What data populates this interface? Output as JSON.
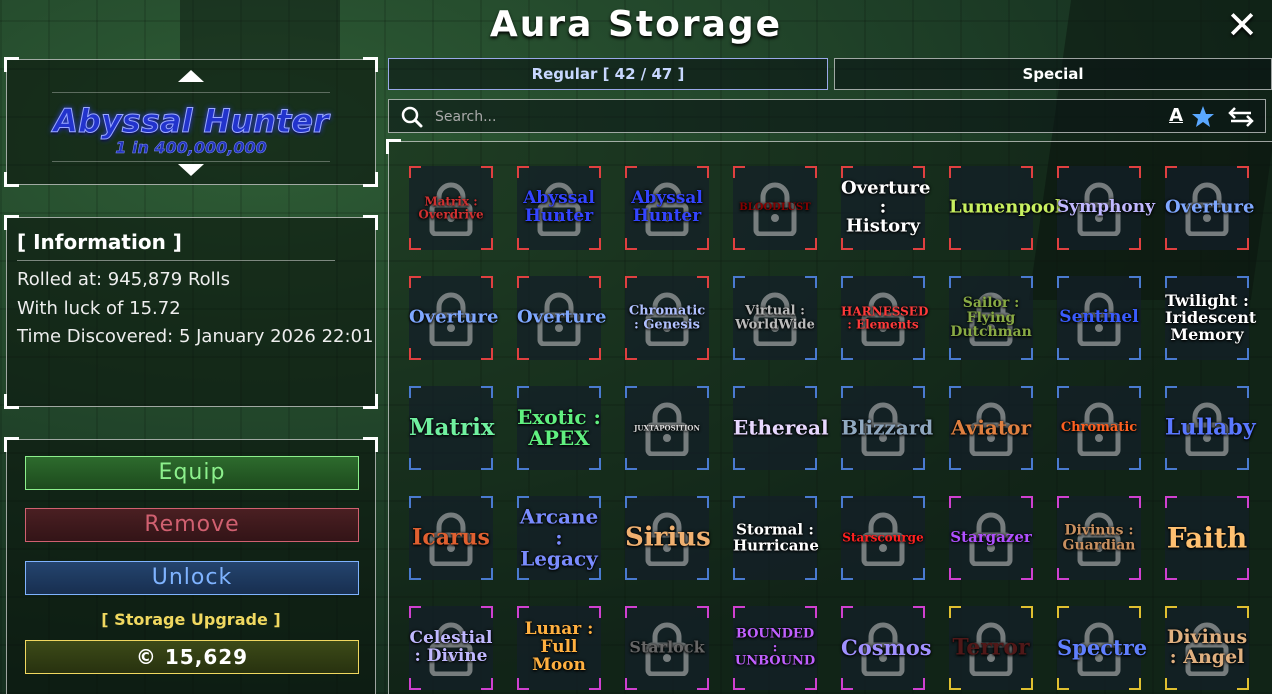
{
  "title": "Aura Storage",
  "close_icon": "close-icon",
  "selected": {
    "name": "Abyssal Hunter",
    "odds": "1 in 400,000,000"
  },
  "info": {
    "heading": "[ Information ]",
    "rolled_at": "Rolled at: 945,879 Rolls",
    "luck": "With luck of 15.72",
    "discovered": "Time Discovered: 5 January 2026 22:01"
  },
  "buttons": {
    "equip": "Equip",
    "remove": "Remove",
    "unlock": "Unlock",
    "upgrade_label": "[ Storage Upgrade ]",
    "price": "© 15,629"
  },
  "tabs": {
    "regular": "Regular [ 42 / 47 ]",
    "special": "Special"
  },
  "search": {
    "placeholder": "Search..."
  },
  "auras": [
    {
      "name": "Matrix : Overdrive",
      "border": "#e04040",
      "locked": true,
      "color": "#d03030",
      "size": 12
    },
    {
      "name": "Abyssal Hunter",
      "border": "#e04040",
      "locked": true,
      "color": "#3344ff",
      "size": 17
    },
    {
      "name": "Abyssal Hunter",
      "border": "#e04040",
      "locked": true,
      "color": "#3344ff",
      "size": 17
    },
    {
      "name": "BLOODLUST",
      "border": "#e04040",
      "locked": true,
      "color": "#880000",
      "size": 10
    },
    {
      "name": "Overture : History",
      "border": "#e04040",
      "locked": false,
      "color": "#ffffff",
      "size": 18
    },
    {
      "name": "Lumenpool",
      "border": "#e04040",
      "locked": false,
      "color": "#c8f060",
      "size": 18
    },
    {
      "name": "Symphony",
      "border": "#e04040",
      "locked": true,
      "color": "#c0b8ff",
      "size": 17
    },
    {
      "name": "Overture",
      "border": "#e04040",
      "locked": true,
      "color": "#7fa8ff",
      "size": 18
    },
    {
      "name": "Overture",
      "border": "#e04040",
      "locked": true,
      "color": "#7fa8ff",
      "size": 18
    },
    {
      "name": "Overture",
      "border": "#e04040",
      "locked": true,
      "color": "#7fa8ff",
      "size": 18
    },
    {
      "name": "Chromatic : Genesis",
      "border": "#e04040",
      "locked": true,
      "color": "#b0c0ff",
      "size": 13
    },
    {
      "name": "Virtual : WorldWide",
      "border": "#4a7ad0",
      "locked": true,
      "color": "#bbbbbb",
      "size": 13
    },
    {
      "name": "HARNESSED : Elements",
      "border": "#4a7ad0",
      "locked": true,
      "color": "#ff3a3a",
      "size": 12
    },
    {
      "name": "Sailor : Flying Dutchman",
      "border": "#4a7ad0",
      "locked": true,
      "color": "#88aa44",
      "size": 14
    },
    {
      "name": "Sentinel",
      "border": "#4a7ad0",
      "locked": true,
      "color": "#3a5cff",
      "size": 17
    },
    {
      "name": "Twilight : Iridescent Memory",
      "border": "#4a7ad0",
      "locked": false,
      "color": "#ffffff",
      "size": 16
    },
    {
      "name": "Matrix",
      "border": "#4a7ad0",
      "locked": false,
      "color": "#70f0a0",
      "size": 23
    },
    {
      "name": "Exotic : APEX",
      "border": "#4a7ad0",
      "locked": false,
      "color": "#60f080",
      "size": 20
    },
    {
      "name": "JUXTAPOSITION",
      "border": "#4a7ad0",
      "locked": true,
      "color": "#dddddd",
      "size": 7
    },
    {
      "name": "Ethereal",
      "border": "#4a7ad0",
      "locked": false,
      "color": "#e8d8ff",
      "size": 20
    },
    {
      "name": "Blizzard",
      "border": "#4a7ad0",
      "locked": true,
      "color": "#90a8c0",
      "size": 20
    },
    {
      "name": "Aviator",
      "border": "#4a7ad0",
      "locked": true,
      "color": "#e08040",
      "size": 20
    },
    {
      "name": "Chromatic",
      "border": "#4a7ad0",
      "locked": true,
      "color": "#ff6020",
      "size": 13
    },
    {
      "name": "Lullaby",
      "border": "#4a7ad0",
      "locked": true,
      "color": "#5a78ff",
      "size": 22
    },
    {
      "name": "Icarus",
      "border": "#4a7ad0",
      "locked": true,
      "color": "#e06030",
      "size": 22
    },
    {
      "name": "Arcane : Legacy",
      "border": "#4a7ad0",
      "locked": false,
      "color": "#7a8cff",
      "size": 20
    },
    {
      "name": "Sirius",
      "border": "#4a7ad0",
      "locked": true,
      "color": "#f0b070",
      "size": 26
    },
    {
      "name": "Stormal : Hurricane",
      "border": "#4a7ad0",
      "locked": false,
      "color": "#ffffff",
      "size": 15
    },
    {
      "name": "Starscourge",
      "border": "#4a7ad0",
      "locked": true,
      "color": "#ff2020",
      "size": 12
    },
    {
      "name": "Stargazer",
      "border": "#d040d0",
      "locked": true,
      "color": "#b050ff",
      "size": 15
    },
    {
      "name": "Divinus : Guardian",
      "border": "#d040d0",
      "locked": true,
      "color": "#c89060",
      "size": 14
    },
    {
      "name": "Faith",
      "border": "#d040d0",
      "locked": false,
      "color": "#ffc070",
      "size": 28
    },
    {
      "name": "Celestial : Divine",
      "border": "#d040d0",
      "locked": true,
      "color": "#c0b8ff",
      "size": 17
    },
    {
      "name": "Lunar : Full Moon",
      "border": "#d040d0",
      "locked": false,
      "color": "#ffb040",
      "size": 17
    },
    {
      "name": "Starlock",
      "border": "#d040d0",
      "locked": true,
      "color": "#666666",
      "size": 16
    },
    {
      "name": "BOUNDED : UNBOUND",
      "border": "#d040d0",
      "locked": false,
      "color": "#c060ff",
      "size": 13
    },
    {
      "name": "Cosmos",
      "border": "#d040d0",
      "locked": true,
      "color": "#a090ff",
      "size": 21
    },
    {
      "name": "Terror",
      "border": "#e0c030",
      "locked": true,
      "color": "#501818",
      "size": 22
    },
    {
      "name": "Spectre",
      "border": "#e0c030",
      "locked": true,
      "color": "#6080ff",
      "size": 21
    },
    {
      "name": "Divinus : Angel",
      "border": "#e0c030",
      "locked": true,
      "color": "#e0b080",
      "size": 19
    }
  ]
}
